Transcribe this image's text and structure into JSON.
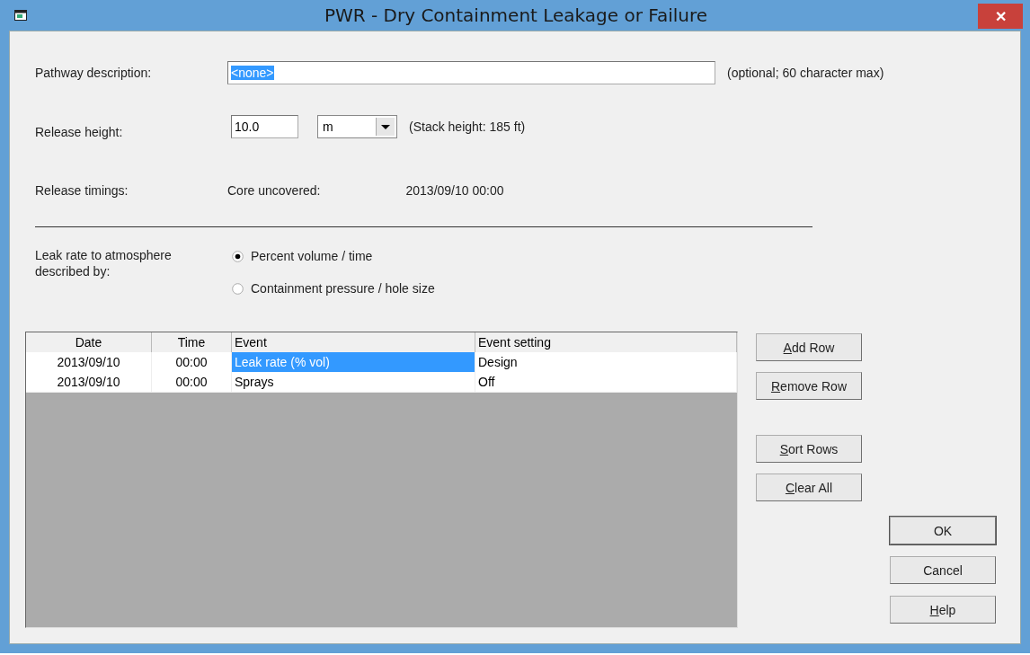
{
  "window": {
    "title": "PWR - Dry Containment Leakage or Failure",
    "close": "✕"
  },
  "pathway": {
    "label": "Pathway description:",
    "value": "<none>",
    "value_selected": true,
    "hint": "(optional; 60 character max)"
  },
  "release_height": {
    "label": "Release height:",
    "value": "10.0",
    "unit": "m",
    "note": "(Stack height: 185 ft)"
  },
  "release_timings": {
    "label": "Release timings:",
    "event": "Core uncovered:",
    "time": "2013/09/10 00:00"
  },
  "leak_rate": {
    "label": "Leak rate to atmosphere described by:",
    "options": [
      {
        "label": "Percent volume / time",
        "selected": true
      },
      {
        "label": "Containment pressure / hole size",
        "selected": false
      }
    ]
  },
  "table": {
    "columns": [
      "Date",
      "Time",
      "Event",
      "Event setting"
    ],
    "rows": [
      {
        "cells": [
          "2013/09/10",
          "00:00",
          "Leak rate (% vol)",
          "Design"
        ],
        "selected": true
      },
      {
        "cells": [
          "2013/09/10",
          "00:00",
          "Sprays",
          "Off"
        ],
        "selected": false
      }
    ]
  },
  "row_buttons": [
    {
      "key": "A",
      "after": "dd Row"
    },
    {
      "key": "R",
      "after": "emove Row"
    },
    {
      "key": "S",
      "after": "ort Rows"
    },
    {
      "key": "C",
      "after": "lear All"
    }
  ],
  "dialog_buttons": [
    {
      "after": "OK",
      "default": true
    },
    {
      "after": "Cancel",
      "default": false
    },
    {
      "key": "H",
      "after": "elp",
      "default": false
    }
  ]
}
